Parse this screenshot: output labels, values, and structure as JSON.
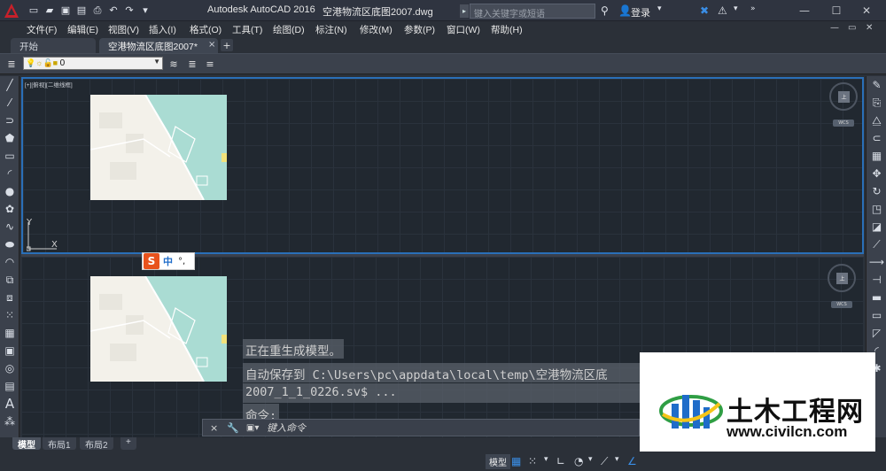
{
  "titlebar": {
    "app_title": "Autodesk AutoCAD 2016",
    "file_name": "空港物流区底图2007.dwg",
    "search_placeholder": "键入关键字或短语",
    "login_label": "登录",
    "qat_icons": [
      "new-icon",
      "open-icon",
      "save-icon",
      "saveas-icon",
      "print-icon",
      "undo-icon",
      "redo-icon",
      "dropdown-icon"
    ]
  },
  "menu": {
    "items": [
      "文件(F)",
      "编辑(E)",
      "视图(V)",
      "插入(I)",
      "格式(O)",
      "工具(T)",
      "绘图(D)",
      "标注(N)",
      "修改(M)",
      "参数(P)",
      "窗口(W)",
      "帮助(H)"
    ]
  },
  "doctabs": {
    "start_label": "开始",
    "active_label": "空港物流区底图2007*",
    "close_symbol": "×",
    "new_symbol": "+"
  },
  "layer": {
    "current": "0"
  },
  "viewports": {
    "top_label": "[+][俯视][二维线框]",
    "view_face": "上",
    "wcs_label": "WCS",
    "ucs_x": "X",
    "ucs_y": "Y"
  },
  "ime": {
    "logo": "S",
    "lang": "中",
    "punct": "°,"
  },
  "command": {
    "history": [
      "正在重生成模型。",
      "自动保存到 C:\\Users\\pc\\appdata\\local\\temp\\空港物流区底",
      "2007_1_1_0226.sv$ ...",
      "命令:"
    ],
    "placeholder": "键入命令",
    "close_symbol": "×"
  },
  "layouts": {
    "tabs": [
      "模型",
      "布局1",
      "布局2"
    ],
    "add_symbol": "+"
  },
  "status": {
    "model_label": "模型"
  },
  "watermark": {
    "title": "土木工程网",
    "url": "www.civilcn.com"
  },
  "colors": {
    "accent_blue": "#2a6fb8",
    "canvas": "#212830",
    "map_water": "#aadcd3",
    "map_land": "#f3f1ea"
  }
}
